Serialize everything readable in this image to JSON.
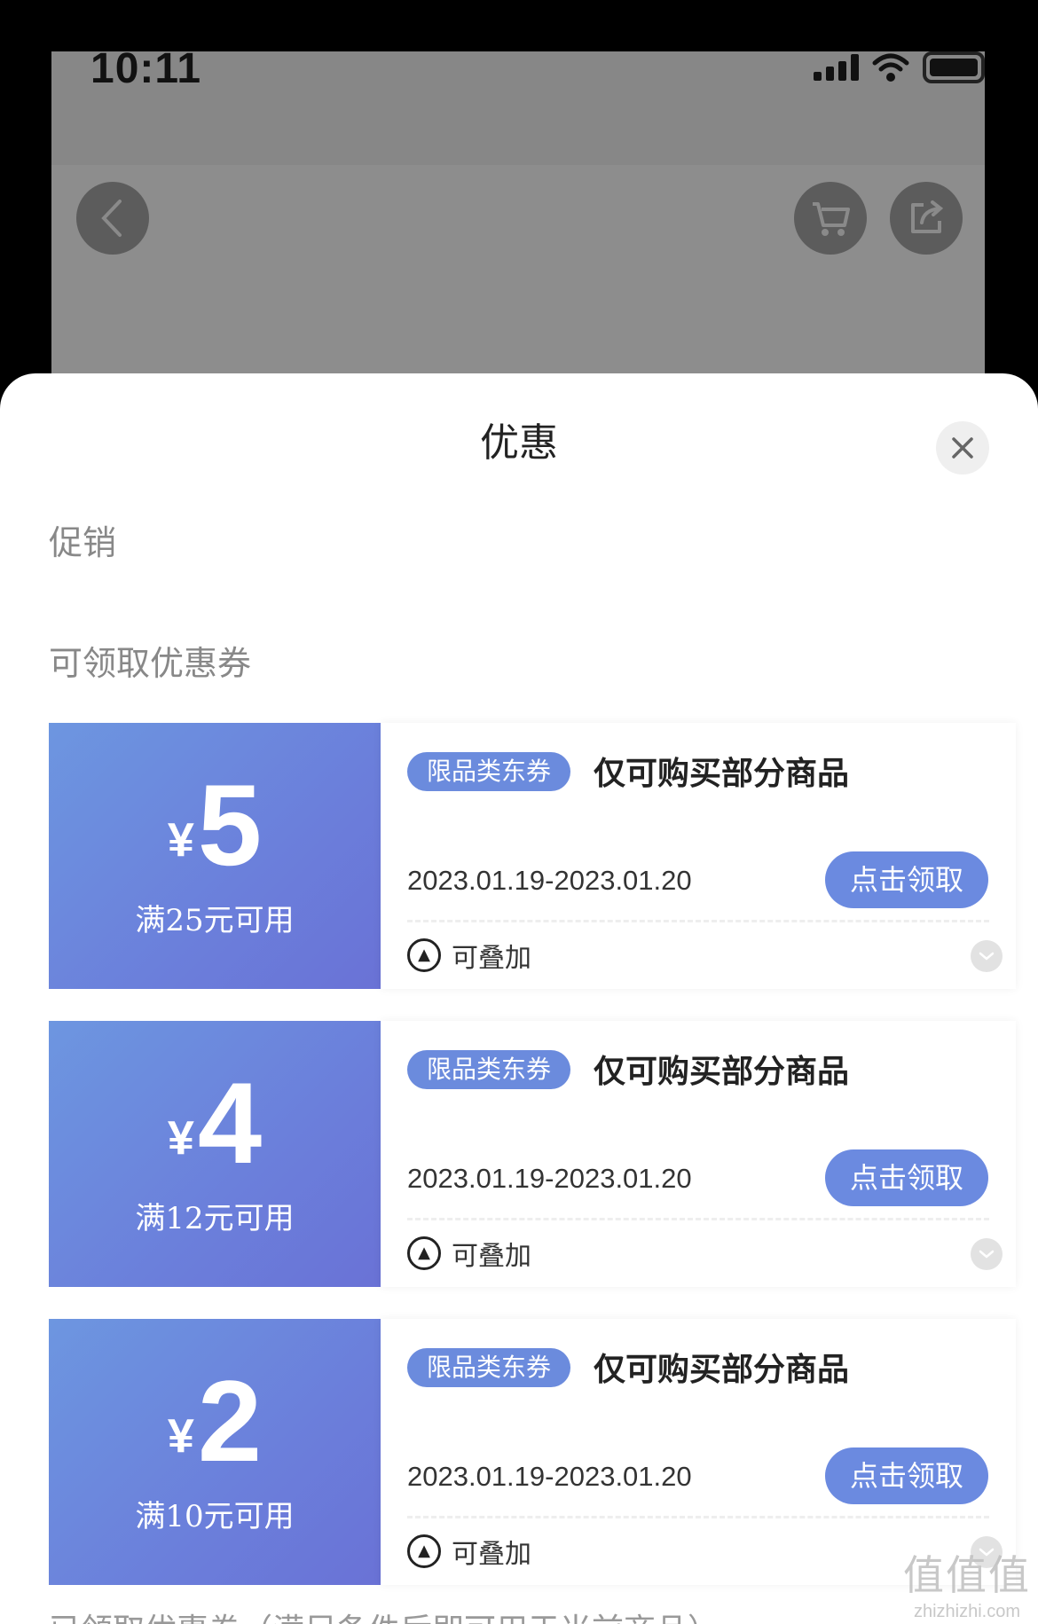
{
  "status_bar": {
    "time": "10:11"
  },
  "sheet": {
    "title": "优惠",
    "section_promo": "促销",
    "section_coupons": "可领取优惠券",
    "bottom_partial": "已领取优惠券（满足条件后即可用于当前商品）"
  },
  "coupons": [
    {
      "currency": "¥",
      "amount": "5",
      "condition": "满25元可用",
      "tag": "限品类东券",
      "description": "仅可购买部分商品",
      "dates": "2023.01.19-2023.01.20",
      "claim_label": "点击领取",
      "stack_label": "可叠加"
    },
    {
      "currency": "¥",
      "amount": "4",
      "condition": "满12元可用",
      "tag": "限品类东券",
      "description": "仅可购买部分商品",
      "dates": "2023.01.19-2023.01.20",
      "claim_label": "点击领取",
      "stack_label": "可叠加"
    },
    {
      "currency": "¥",
      "amount": "2",
      "condition": "满10元可用",
      "tag": "限品类东券",
      "description": "仅可购买部分商品",
      "dates": "2023.01.19-2023.01.20",
      "claim_label": "点击领取",
      "stack_label": "可叠加"
    }
  ],
  "watermark": {
    "main": "值值值",
    "sub": "zhizhizhi.com"
  },
  "colors": {
    "coupon_gradient_start": "#6d96e0",
    "coupon_gradient_end": "#6a72d6",
    "tag_bg": "#6b8bdd",
    "button_bg": "#6b8ae0"
  },
  "icons": [
    "back-arrow-icon",
    "cart-icon",
    "share-icon",
    "close-icon",
    "stack-icon",
    "chevron-down-icon",
    "signal-icon",
    "wifi-icon",
    "battery-icon"
  ]
}
